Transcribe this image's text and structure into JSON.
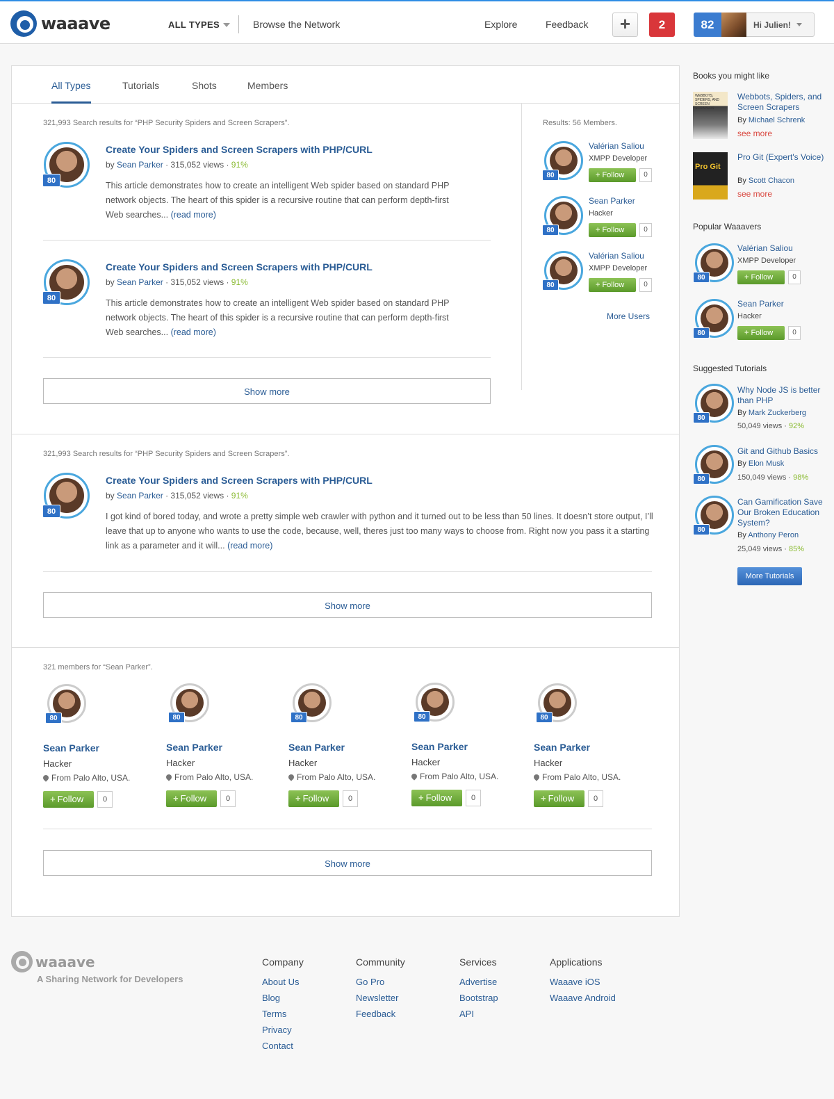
{
  "header": {
    "logo_text": "waaave",
    "types_dropdown": "ALL TYPES",
    "browse_link": "Browse the Network",
    "explore_link": "Explore",
    "feedback_link": "Feedback",
    "plus_label": "+",
    "notifications_count": "2",
    "user_score": "82",
    "user_greeting": "Hi Julien!"
  },
  "tabs": [
    "All Types",
    "Tutorials",
    "Shots",
    "Members"
  ],
  "section1": {
    "count_text": "321,993 Search results for “PHP Security Spiders and Screen Scrapers”.",
    "articles": [
      {
        "badge": "80",
        "title": "Create Your Spiders and Screen Scrapers with PHP/CURL",
        "by": "by",
        "author": "Sean Parker",
        "views": "315,052 views",
        "pct": "91%",
        "desc": "This article demonstrates how to create an intelligent Web spider based on standard PHP network objects. The heart of this spider is a recursive routine that can perform depth-first Web searches...",
        "read_more": "(read more)"
      },
      {
        "badge": "80",
        "title": "Create Your Spiders and Screen Scrapers with PHP/CURL",
        "by": "by",
        "author": "Sean Parker",
        "views": "315,052 views",
        "pct": "91%",
        "desc": "This article demonstrates how to create an intelligent Web spider based on standard PHP network objects. The heart of this spider is a recursive routine that can perform depth-first Web searches...",
        "read_more": "(read more)"
      }
    ],
    "show_more": "Show more",
    "members_count": "Results: 56 Members.",
    "members": [
      {
        "badge": "80",
        "name": "Valérian Saliou",
        "role": "XMPP Developer",
        "follow": "Follow",
        "count": "0"
      },
      {
        "badge": "80",
        "name": "Sean Parker",
        "role": "Hacker",
        "follow": "Follow",
        "count": "0"
      },
      {
        "badge": "80",
        "name": "Valérian Saliou",
        "role": "XMPP Developer",
        "follow": "Follow",
        "count": "0"
      }
    ],
    "more_users": "More Users"
  },
  "section2": {
    "count_text": "321,993 Search results for “PHP Security Spiders and Screen Scrapers”.",
    "article": {
      "badge": "80",
      "title": "Create Your Spiders and Screen Scrapers with PHP/CURL",
      "by": "by",
      "author": "Sean Parker",
      "views": "315,052 views",
      "pct": "91%",
      "desc": "I got kind of bored today, and wrote a pretty simple web crawler with python and it turned out to be less than 50 lines. It doesn’t store output, I’ll leave that up to anyone who wants to use the code, because, well, theres just too many ways to choose from. Right now you pass it a starting link as a parameter and it will...",
      "read_more": "(read more)"
    },
    "show_more": "Show more"
  },
  "section3": {
    "count_text": "321 members for “Sean Parker”.",
    "members": [
      {
        "badge": "80",
        "name": "Sean Parker",
        "role": "Hacker",
        "location": "From Palo Alto, USA.",
        "follow": "Follow",
        "count": "0"
      },
      {
        "badge": "80",
        "name": "Sean Parker",
        "role": "Hacker",
        "location": "From Palo Alto, USA.",
        "follow": "Follow",
        "count": "0"
      },
      {
        "badge": "80",
        "name": "Sean Parker",
        "role": "Hacker",
        "location": "From Palo Alto, USA.",
        "follow": "Follow",
        "count": "0"
      },
      {
        "badge": "80",
        "name": "Sean Parker",
        "role": "Hacker",
        "location": "From Palo Alto, USA.",
        "follow": "Follow",
        "count": "0"
      },
      {
        "badge": "80",
        "name": "Sean Parker",
        "role": "Hacker",
        "location": "From Palo Alto, USA.",
        "follow": "Follow",
        "count": "0"
      }
    ],
    "show_more": "Show more"
  },
  "sidebar": {
    "books_heading": "Books you might like",
    "books": [
      {
        "title": "Webbots, Spiders, and Screen Scrapers",
        "by": "By",
        "author": "Michael Schrenk",
        "see_more": "see more",
        "cover_text": "WEBBOTS, SPIDERS, AND SCREEN SCRAPERS"
      },
      {
        "title": "Pro Git (Expert's Voice)",
        "by": "By",
        "author": "Scott Chacon",
        "see_more": "see more",
        "cover_text": "Pro Git"
      }
    ],
    "popular_heading": "Popular Waaavers",
    "popular": [
      {
        "badge": "80",
        "name": "Valérian Saliou",
        "role": "XMPP Developer",
        "follow": "Follow",
        "count": "0"
      },
      {
        "badge": "80",
        "name": "Sean Parker",
        "role": "Hacker",
        "follow": "Follow",
        "count": "0"
      }
    ],
    "tutorials_heading": "Suggested Tutorials",
    "tutorials": [
      {
        "badge": "80",
        "title": "Why Node JS is better than PHP",
        "by": "By",
        "author": "Mark Zuckerberg",
        "views": "50,049 views",
        "pct": "92%"
      },
      {
        "badge": "80",
        "title": "Git and Github Basics",
        "by": "By",
        "author": "Elon Musk",
        "views": "150,049 views",
        "pct": "98%"
      },
      {
        "badge": "80",
        "title": "Can Gamification Save Our Broken Education System?",
        "by": "By",
        "author": "Anthony Peron",
        "views": "25,049 views",
        "pct": "85%"
      }
    ],
    "more_tutorials": "More Tutorials"
  },
  "footer": {
    "logo_text": "waaave",
    "tagline": "A Sharing Network for Developers",
    "columns": [
      {
        "heading": "Company",
        "links": [
          "About Us",
          "Blog",
          "Terms",
          "Privacy",
          "Contact"
        ]
      },
      {
        "heading": "Community",
        "links": [
          "Go Pro",
          "Newsletter",
          "Feedback"
        ]
      },
      {
        "heading": "Services",
        "links": [
          "Advertise",
          "Bootstrap",
          "API"
        ]
      },
      {
        "heading": "Applications",
        "links": [
          "Waaave iOS",
          "Waaave Android"
        ]
      }
    ]
  },
  "colors": {
    "accent": "#2a5c95",
    "badge": "#2f71c6",
    "follow": "#6aa93a",
    "notify": "#d9363a",
    "percent": "#8bbb33",
    "see_more": "#d9463e"
  },
  "icons": [
    "logo-icon",
    "chevron-down-icon",
    "plus-icon",
    "location-pin-icon"
  ]
}
